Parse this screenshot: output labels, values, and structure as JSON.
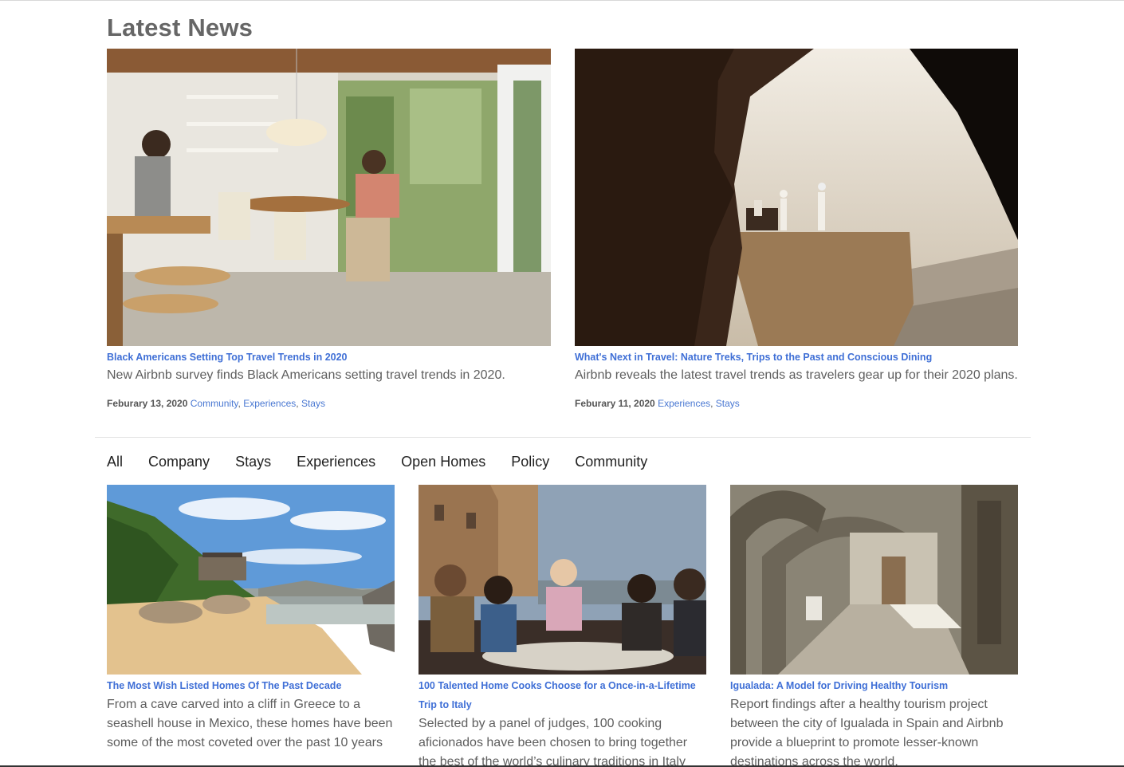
{
  "page": {
    "title": "Latest News"
  },
  "featured": [
    {
      "image_alt": "Two men in a bright modern kitchen with floor-to-ceiling windows",
      "title": "Black Americans Setting Top Travel Trends in 2020",
      "description": "New Airbnb survey finds Black Americans setting travel trends in 2020.",
      "date": "Feburary 13, 2020",
      "tags": [
        "Community",
        "Experiences",
        "Stays"
      ]
    },
    {
      "image_alt": "Group of people on a cliff edge seen through a rock opening",
      "title": "What's Next in Travel: Nature Treks, Trips to the Past and Conscious Dining",
      "description": "Airbnb reveals the latest travel trends as travelers gear up for their 2020 plans.",
      "date": "Feburary 11, 2020",
      "tags": [
        "Experiences",
        "Stays"
      ]
    }
  ],
  "filters": [
    "All",
    "Company",
    "Stays",
    "Experiences",
    "Open Homes",
    "Policy",
    "Community"
  ],
  "grid": [
    {
      "image_alt": "Beach house among rocks by the sea",
      "title": "The Most Wish Listed Homes Of The Past Decade",
      "description": "From a cave carved into a cliff in Greece to a seashell house in Mexico, these homes have been some of the most coveted over the past 10 years"
    },
    {
      "image_alt": "Family sharing a meal outdoors in front of a stone building",
      "title": "100 Talented Home Cooks Choose for a Once-in-a-Lifetime Trip to Italy",
      "description": "Selected by a panel of judges, 100 cooking aficionados have been chosen to bring together the best of the world’s culinary traditions in Italy"
    },
    {
      "image_alt": "Stone arcade street with arches",
      "title": "Igualada: A Model for Driving Healthy Tourism",
      "description": "Report findings after a healthy tourism project between the city of Igualada in Spain and Airbnb provide a blueprint to promote lesser-known destinations across the world."
    }
  ],
  "colors": {
    "link": "#3f6fd6",
    "tag": "#4a78d2",
    "heading": "#666666",
    "text": "#5e5e5e"
  }
}
